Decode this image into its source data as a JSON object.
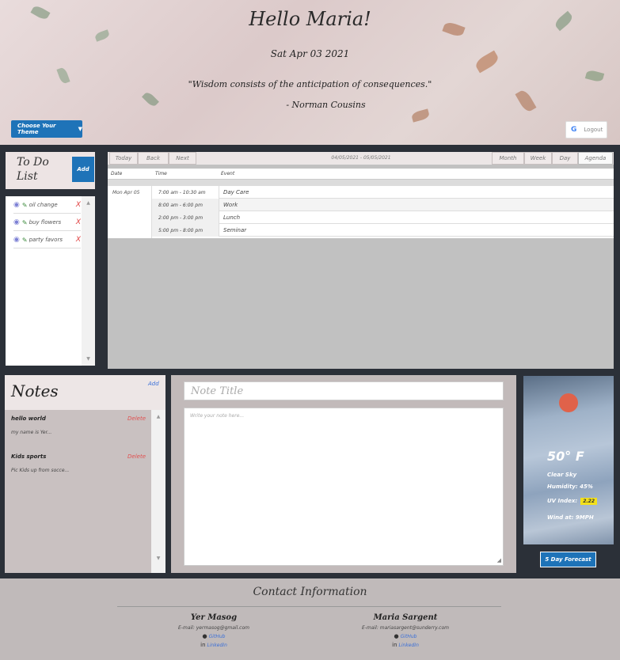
{
  "header": {
    "greeting": "Hello Maria!",
    "date": "Sat Apr 03 2021",
    "quote": "\"Wisdom consists of the anticipation of consequences.\"",
    "author": "- Norman Cousins",
    "theme_button": "Choose Your Theme",
    "logout": "Logout",
    "google_icon": "G"
  },
  "todo": {
    "title": "To Do List",
    "add_label": "Add",
    "items": [
      {
        "label": "oil change",
        "delete": "X"
      },
      {
        "label": "buy flowers",
        "delete": "X"
      },
      {
        "label": "party favors",
        "delete": "X"
      }
    ]
  },
  "calendar": {
    "buttons": {
      "today": "Today",
      "back": "Back",
      "next": "Next",
      "month": "Month",
      "week": "Week",
      "day": "Day",
      "agenda": "Agenda"
    },
    "range": "04/05/2021 - 05/05/2021",
    "headers": {
      "date": "Date",
      "time": "Time",
      "event": "Event"
    },
    "day": "Mon Apr 05",
    "events": [
      {
        "time": "7:00 am - 10:30 am",
        "event": "Day Care"
      },
      {
        "time": "8:00 am - 6:00 pm",
        "event": "Work"
      },
      {
        "time": "2:00 pm - 3:00 pm",
        "event": "Lunch"
      },
      {
        "time": "5:00 pm - 8:00 pm",
        "event": "Seminar"
      }
    ]
  },
  "notes": {
    "title": "Notes",
    "add_label": "Add",
    "items": [
      {
        "title": "hello world",
        "delete": "Delete",
        "body": "my name is Yer..."
      },
      {
        "title": "Kids sports",
        "delete": "Delete",
        "body": "Pic Kids up from socce..."
      }
    ]
  },
  "editor": {
    "title_placeholder": "Note Title",
    "body_placeholder": "Write your note here..."
  },
  "weather": {
    "temp": "50° F",
    "condition": "Clear Sky",
    "humidity": "Humidity: 45%",
    "uv_label": "UV Index:",
    "uv_value": "2.22",
    "wind": "Wind at: 9MPH",
    "forecast_button": "5 Day Forecast"
  },
  "footer": {
    "title": "Contact Information",
    "contacts": [
      {
        "name": "Yer Masog",
        "email": "E-mail: yermasog@gmail.com",
        "github": "GitHub",
        "linkedin": "LinkedIn"
      },
      {
        "name": "Maria Sargent",
        "email": "E-mail: mariasargent@sunderry.com",
        "github": "GitHub",
        "linkedin": "LinkedIn"
      }
    ]
  }
}
